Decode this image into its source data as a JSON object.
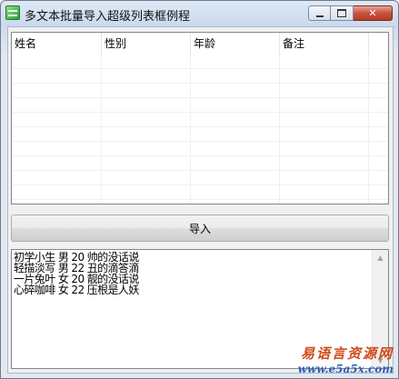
{
  "window": {
    "title": "多文本批量导入超级列表框例程"
  },
  "listview": {
    "columns": [
      "姓名",
      "性别",
      "年龄",
      "备注"
    ]
  },
  "import_button": {
    "label": "导入"
  },
  "editbox": {
    "lines": [
      "初学小生 男 20 帅的没话说",
      "轻描淡写 男 22 丑的滴答滴",
      "一片兔叶 女 20 靓的没话说",
      "心碎咖啡 女 22 压根是人妖"
    ]
  },
  "watermark": {
    "name": "易语言资源网",
    "url": "www.e5a5x.com"
  },
  "colors": {
    "close_button": "#c8523d",
    "watermark_name": "#d04a18",
    "watermark_url": "#2b5fb5"
  }
}
